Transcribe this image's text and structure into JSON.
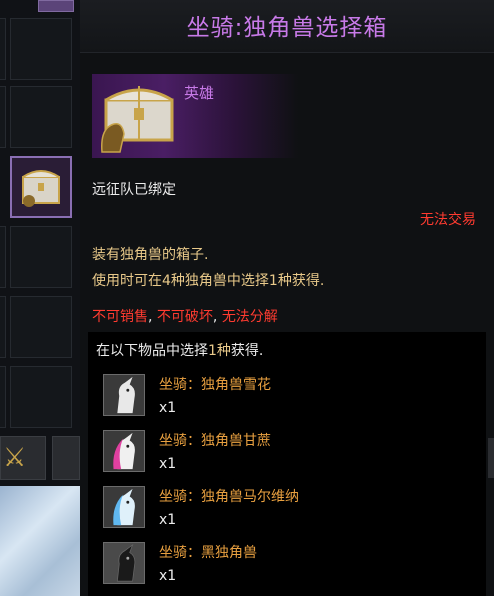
{
  "tooltip": {
    "title": "坐骑:独角兽选择箱",
    "grade": "英雄",
    "binding": "远征队已绑定",
    "trade_status": "无法交易",
    "description_1": "装有独角兽的箱子.",
    "description_2": "使用时可在4种独角兽中选择1种获得.",
    "restrictions": [
      {
        "text": "不可销售",
        "sep": ", "
      },
      {
        "text": "不可破坏",
        "sep": ", "
      },
      {
        "text": "无法分解",
        "sep": ""
      }
    ],
    "choose": {
      "prefix": "在以下物品中选择",
      "count": "1种",
      "suffix": "获得."
    },
    "items": [
      {
        "name": "坐骑：独角兽雪花",
        "qty": "x1",
        "icon": "white-unicorn-icon",
        "color": "#e8e8e8"
      },
      {
        "name": "坐骑：独角兽甘蔗",
        "qty": "x1",
        "icon": "pink-unicorn-icon",
        "color": "#e040a0"
      },
      {
        "name": "坐骑：独角兽马尔维纳",
        "qty": "x1",
        "icon": "blue-unicorn-icon",
        "color": "#60b8f0"
      },
      {
        "name": "坐骑：黑独角兽",
        "qty": "x1",
        "icon": "black-unicorn-icon",
        "color": "#2a2a2a"
      }
    ]
  },
  "colors": {
    "title": "#c87ae8",
    "warning": "#ff3b30",
    "description": "#e8c98a",
    "item_name": "#e8a040"
  }
}
